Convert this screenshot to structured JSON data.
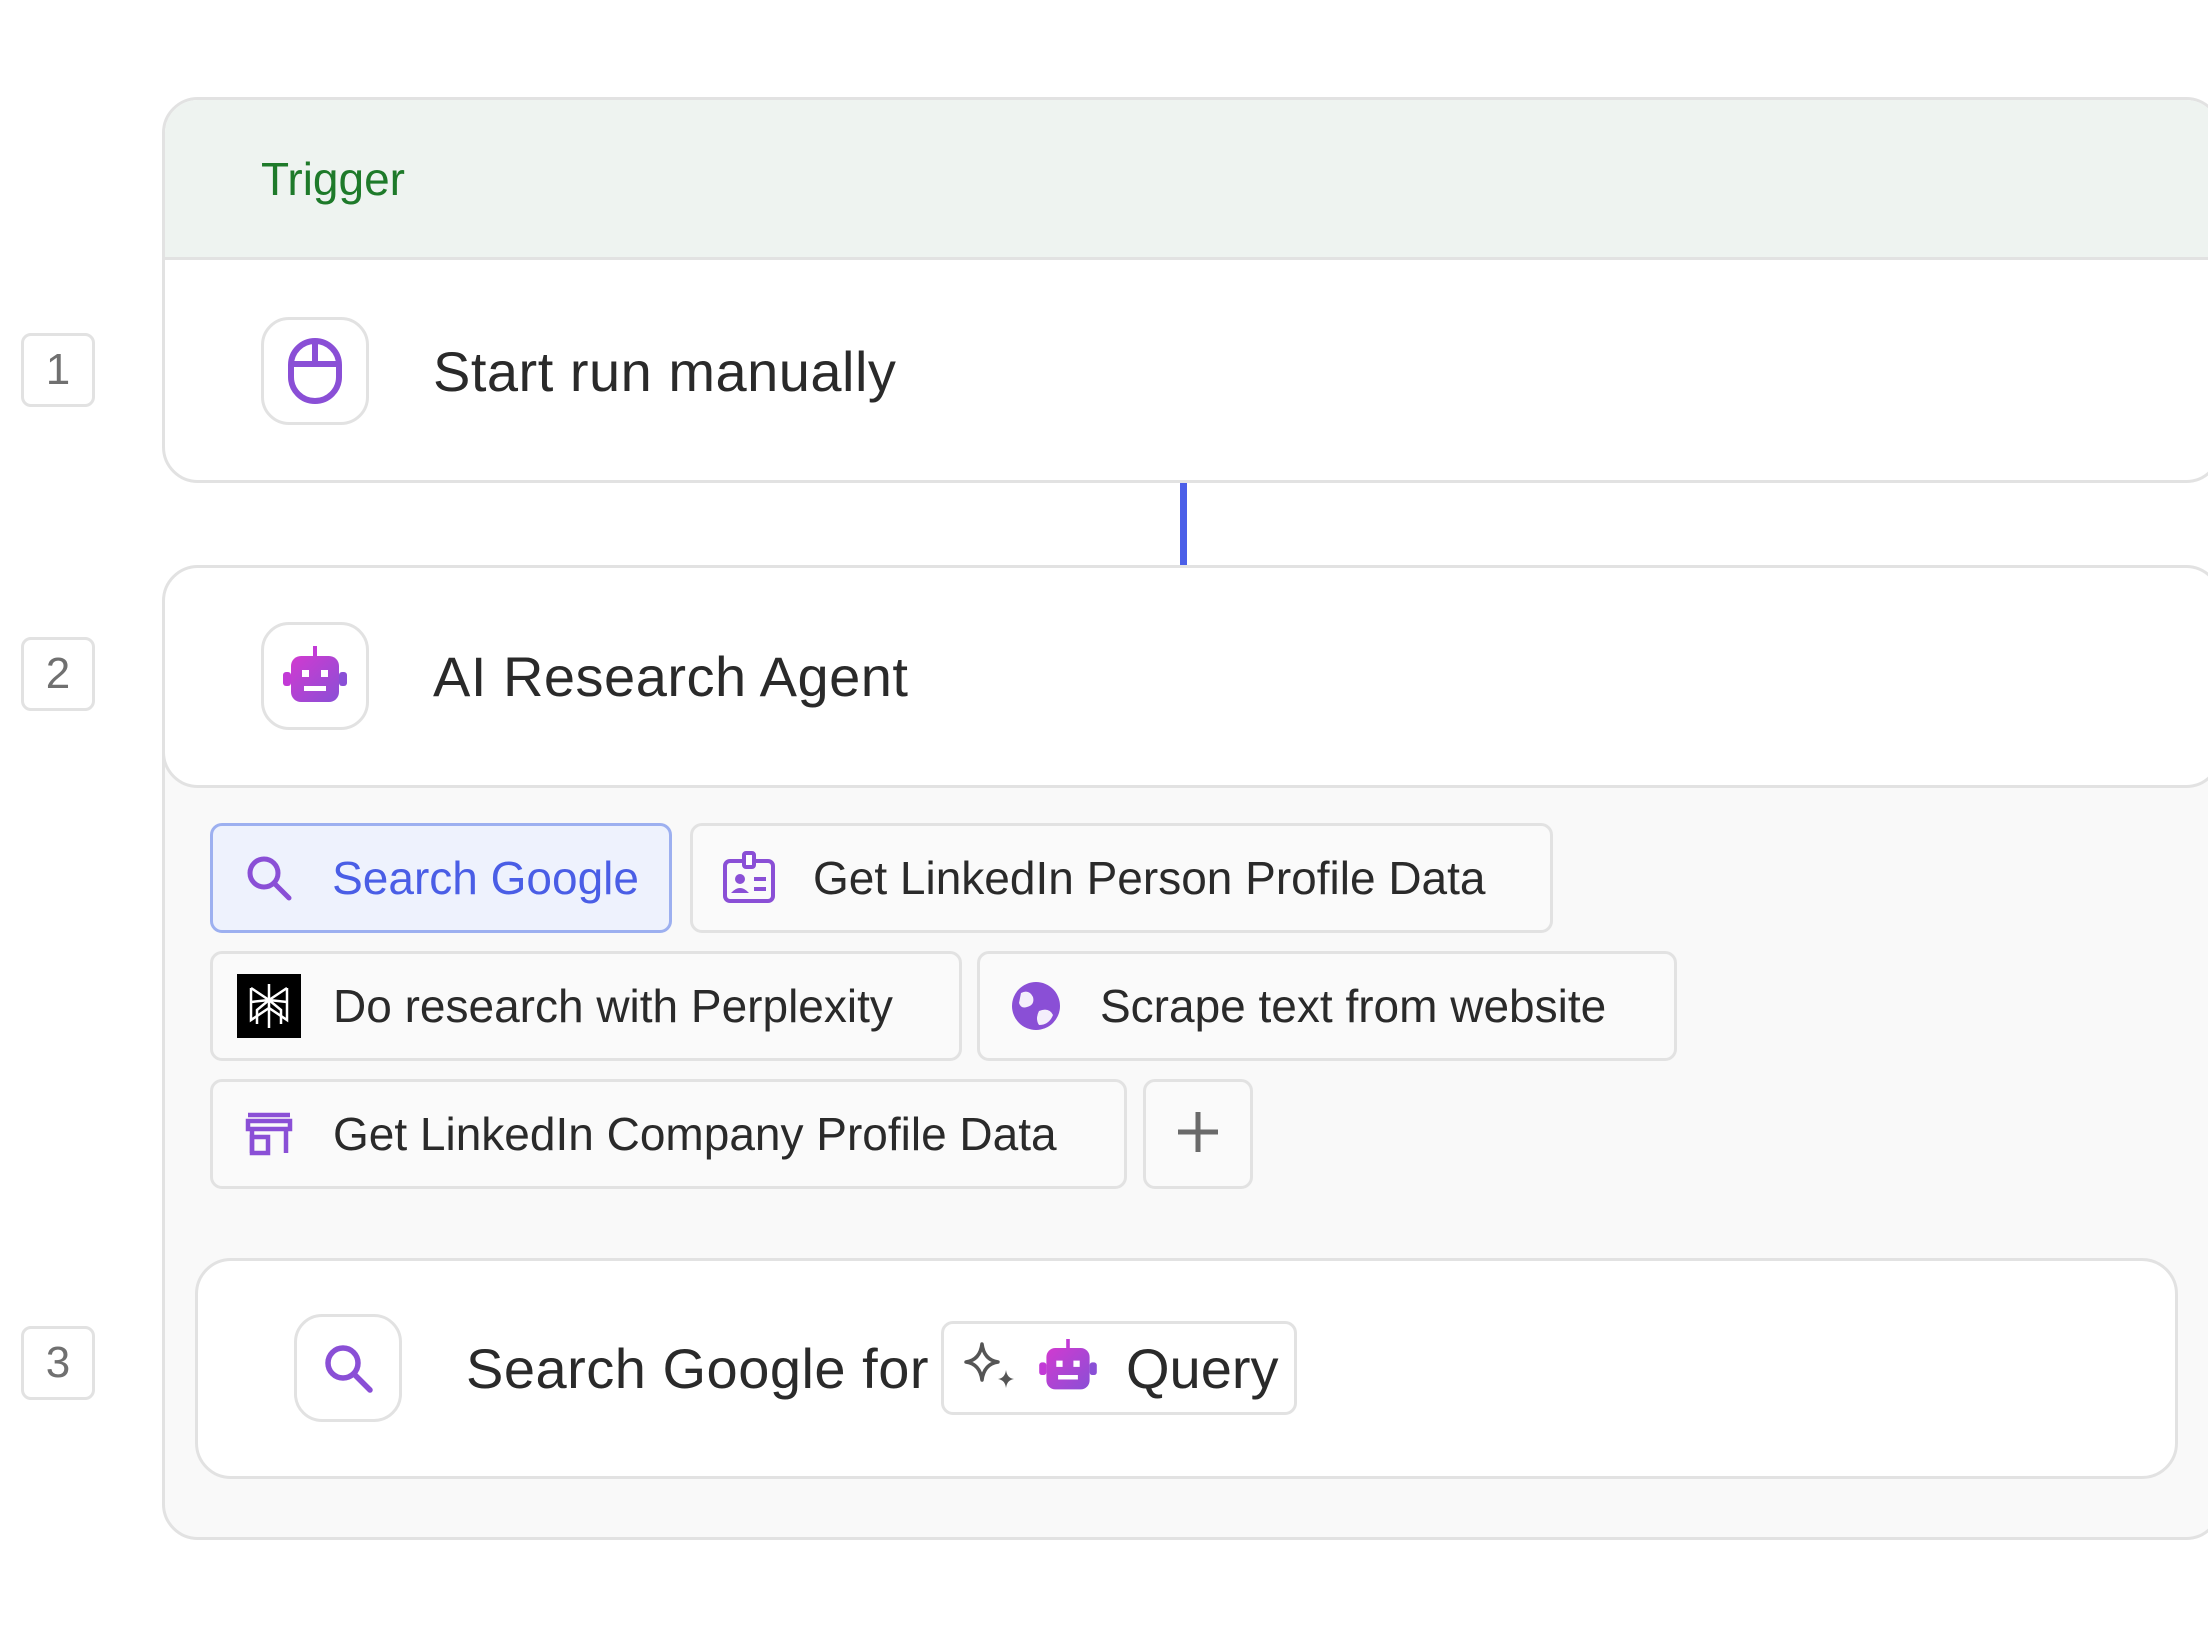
{
  "steps": {
    "one": "1",
    "two": "2",
    "three": "3"
  },
  "trigger": {
    "header_label": "Trigger",
    "action_label": "Start run manually",
    "icon": "mouse-icon"
  },
  "agent": {
    "title": "AI Research Agent",
    "icon": "robot-icon",
    "tools": [
      {
        "label": "Search Google",
        "icon": "search-icon",
        "selected": true
      },
      {
        "label": "Get LinkedIn Person Profile Data",
        "icon": "id-card-icon"
      },
      {
        "label": "Do research with Perplexity",
        "icon": "perplexity-logo-icon"
      },
      {
        "label": "Scrape text from website",
        "icon": "globe-icon"
      },
      {
        "label": "Get LinkedIn Company Profile Data",
        "icon": "storefront-icon"
      }
    ],
    "add_tool": "add-tool"
  },
  "step3": {
    "text": "Search Google for",
    "query_label": "Query",
    "icon": "search-icon"
  },
  "colors": {
    "accent": "#4b5fe8",
    "trigger_green": "#1e7a2a",
    "icon_purple": "#8a4fd6",
    "robot_magenta": "#c23ad6"
  }
}
